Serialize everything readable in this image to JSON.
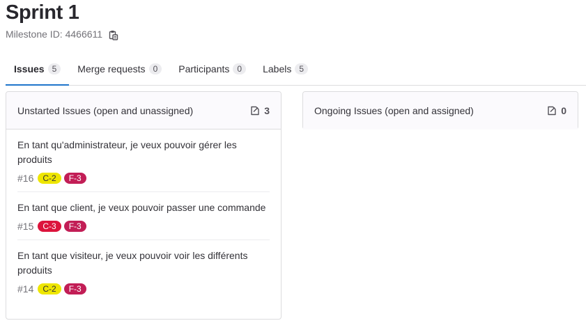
{
  "page": {
    "title": "Sprint 1",
    "milestone_id_text": "Milestone ID: 4466611"
  },
  "tabs": [
    {
      "label": "Issues",
      "count": "5",
      "active": true
    },
    {
      "label": "Merge requests",
      "count": "0"
    },
    {
      "label": "Participants",
      "count": "0"
    },
    {
      "label": "Labels",
      "count": "5"
    }
  ],
  "panels": {
    "unstarted": {
      "title": "Unstarted Issues (open and unassigned)",
      "count": "3",
      "issues": [
        {
          "title": "En tant qu'administrateur, je veux pouvoir gérer les produits",
          "ref": "#16",
          "labels": [
            {
              "text": "C-2",
              "bg": "#eee600",
              "fg": "#333238"
            },
            {
              "text": "F-3",
              "bg": "#c21e56",
              "fg": "#ffffff"
            }
          ]
        },
        {
          "title": "En tant que client, je veux pouvoir passer une commande",
          "ref": "#15",
          "labels": [
            {
              "text": "C-3",
              "bg": "#dc143c",
              "fg": "#ffffff"
            },
            {
              "text": "F-3",
              "bg": "#c21e56",
              "fg": "#ffffff"
            }
          ]
        },
        {
          "title": "En tant que visiteur, je veux pouvoir voir les différents produits",
          "ref": "#14",
          "labels": [
            {
              "text": "C-2",
              "bg": "#eee600",
              "fg": "#333238"
            },
            {
              "text": "F-3",
              "bg": "#c21e56",
              "fg": "#ffffff"
            }
          ]
        }
      ]
    },
    "ongoing": {
      "title": "Ongoing Issues (open and assigned)",
      "count": "0"
    }
  },
  "icons": {
    "copy": "copy-to-clipboard-icon",
    "issues": "issues-icon"
  },
  "colors": {
    "accent": "#1f75cb"
  }
}
